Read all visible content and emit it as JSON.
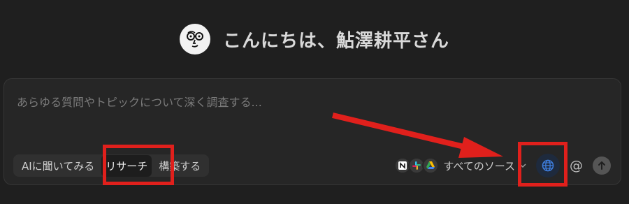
{
  "greeting": {
    "text": "こんにちは、鮎澤耕平さん"
  },
  "composer": {
    "placeholder": "あらゆる質問やトピックについて深く調査する...",
    "modes": [
      {
        "label": "AIに聞いてみる",
        "active": false
      },
      {
        "label": "リサーチ",
        "active": true
      },
      {
        "label": "構築する",
        "active": false
      }
    ],
    "source_icons": [
      "notion-icon",
      "slack-icon",
      "google-drive-icon"
    ],
    "sources_label": "すべてのソース",
    "at_symbol": "@"
  },
  "colors": {
    "background": "#1f1f1f",
    "composer": "#262626",
    "annotation": "#e0201c",
    "web_accent": "#3d7bd9"
  }
}
